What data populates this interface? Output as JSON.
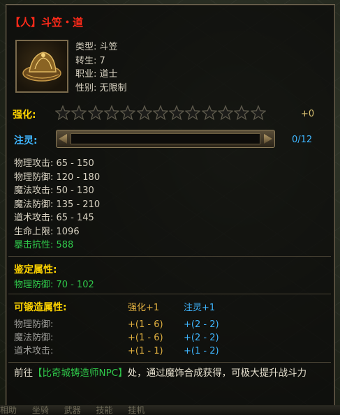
{
  "item": {
    "title": "【人】斗笠・道",
    "icon": "bamboo-hat-icon",
    "info": [
      {
        "label": "类型:",
        "value": "斗笠"
      },
      {
        "label": "转生:",
        "value": "7"
      },
      {
        "label": "职业:",
        "value": "道士"
      },
      {
        "label": "性别:",
        "value": "无限制"
      }
    ]
  },
  "strengthen": {
    "label": "强化:",
    "stars_total": 13,
    "stars_filled": 0,
    "value": "+0",
    "star_color": "#1c1c1a"
  },
  "spirit": {
    "label": "注灵:",
    "value": "0/12",
    "progress": 0,
    "color": "#3fb6ff"
  },
  "stats": [
    {
      "text": "物理攻击: 65 - 150",
      "color": "normal"
    },
    {
      "text": "物理防御: 120 - 180",
      "color": "normal"
    },
    {
      "text": "魔法攻击: 50 - 130",
      "color": "normal"
    },
    {
      "text": "魔法防御: 135 - 210",
      "color": "normal"
    },
    {
      "text": "道术攻击: 65 - 145",
      "color": "normal"
    },
    {
      "text": "生命上限: 1096",
      "color": "normal"
    },
    {
      "text": "暴击抗性: 588",
      "color": "green"
    }
  ],
  "appraise": {
    "title": "鉴定属性:",
    "row": "物理防御: 70 - 102"
  },
  "forge": {
    "title": "可锻造属性:",
    "col_a": "强化+1",
    "col_b": "注灵+1",
    "rows": [
      {
        "name": "物理防御:",
        "a": "+(1 - 6)",
        "b": "+(2 - 2)"
      },
      {
        "name": "魔法防御:",
        "a": "+(1 - 6)",
        "b": "+(2 - 2)"
      },
      {
        "name": "道术攻击:",
        "a": "+(1 - 1)",
        "b": "+(1 - 2)"
      }
    ]
  },
  "footer": {
    "prefix": "前往",
    "link": "【比奇城铸造师NPC】",
    "suffix": "处，通过魔饰合成获得，可极大提升战斗力"
  },
  "bottom_strip": [
    "相助",
    "坐骑",
    "武器",
    "技能",
    "挂机"
  ]
}
